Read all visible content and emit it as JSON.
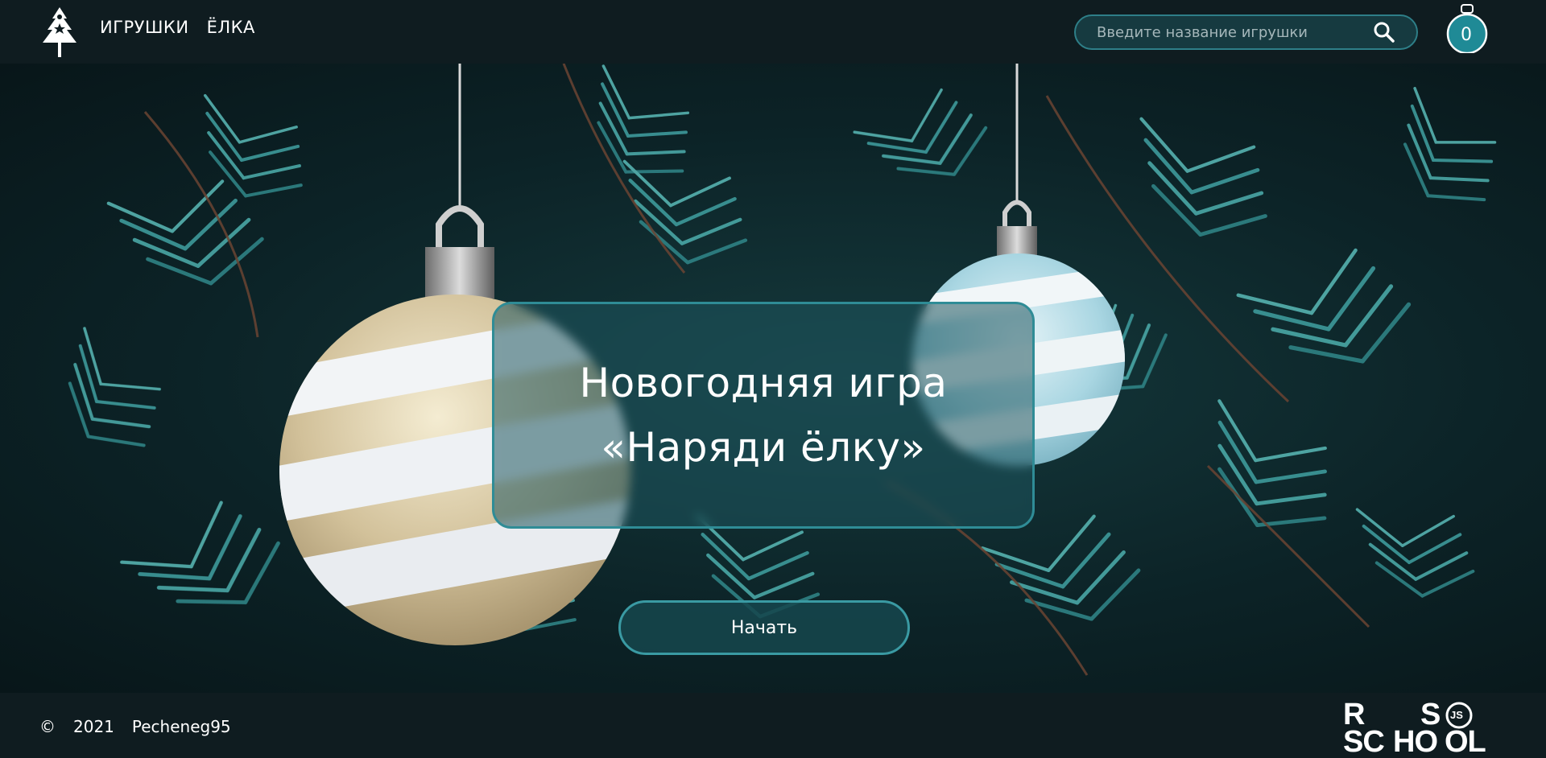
{
  "header": {
    "nav": [
      {
        "label": "ИГРУШКИ"
      },
      {
        "label": "ЁЛКА"
      }
    ],
    "search": {
      "placeholder": "Введите название игрушки",
      "value": ""
    },
    "cart_count": "0"
  },
  "hero": {
    "title_line1": "Новогодняя игра",
    "title_line2": "«Наряди ёлку»",
    "start_label": "Начать"
  },
  "footer": {
    "copyright_symbol": "©",
    "year": "2021",
    "author": "Pecheneg95",
    "rs_logo": {
      "r": "R",
      "s": "S",
      "sc": "SC",
      "ho": "HO",
      "ol": "OL",
      "js": "JS"
    }
  },
  "colors": {
    "accent": "#2f8c96",
    "header_bg": "#0f1c20",
    "counter_bg": "#1f8a96"
  }
}
